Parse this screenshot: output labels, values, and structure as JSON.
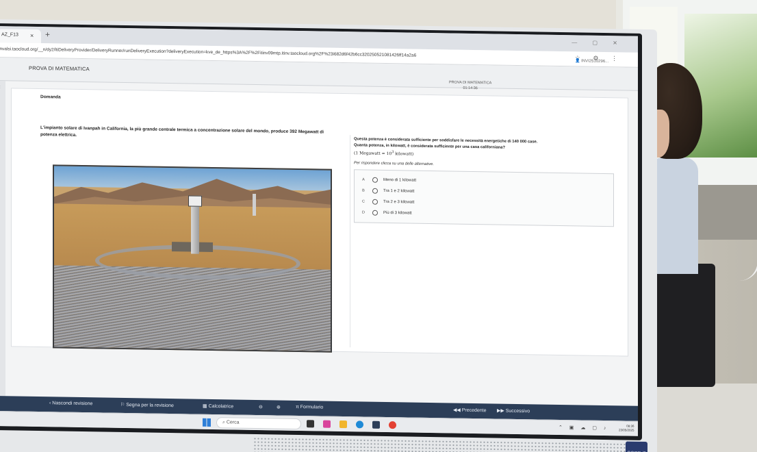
{
  "browser": {
    "tab_title": "AZ_F13",
    "tab_close": "×",
    "new_tab": "+",
    "url": "invalsi.taocloud.org/__n/dy2/ltiDeliveryProvider/DeliveryRunner/runDeliveryExecution?deliveryExecution=kve_de_https%3A%2F%2Fitinv09mtp.itinv.taocloud.org%2F%23i682d6f42b6cc320250521081426ff14a2a6"
  },
  "test_header": {
    "title": "PROVA DI MATEMATICA",
    "center_title": "PROVA DI MATEMATICA",
    "timer": "01:14:36",
    "user": "INVI2510296..."
  },
  "card": {
    "label": "Domanda",
    "stem": "L'impianto solare di Ivanpah in California, la più grande centrale termica a concentrazione solare del mondo, produce 392 Megawatt di potenza elettrica.",
    "question_line1": "Questa potenza è considerata sufficiente per soddisfare le necessità energetiche di 140 000 case.",
    "question_line2": "Quanta potenza, in kilowatt, è considerata sufficiente per una casa californiana?",
    "formula_open": "(1 Megawatt = 10",
    "formula_exp": "3",
    "formula_close": " kilowatt)",
    "instruction": "Per rispondere clicca su una delle alternative.",
    "choices": [
      {
        "letter": "A",
        "text": "Meno di 1 kilowatt"
      },
      {
        "letter": "B",
        "text": "Tra 1 e 2 kilowatt"
      },
      {
        "letter": "C",
        "text": "Tra 2 e 3 kilowatt"
      },
      {
        "letter": "D",
        "text": "Più di 3 kilowatt"
      }
    ]
  },
  "navbar": {
    "hide_review": "Nascondi revisione",
    "mark_review": "Segna per la revisione",
    "calculator": "Calcolatrice",
    "formulas": "Formulario",
    "previous": "Precedente",
    "next": "Successivo"
  },
  "taskbar": {
    "search": "Cerca",
    "time": "08:36",
    "date": "23/05/2025"
  },
  "hardware": {
    "badge": "CORE i5"
  }
}
